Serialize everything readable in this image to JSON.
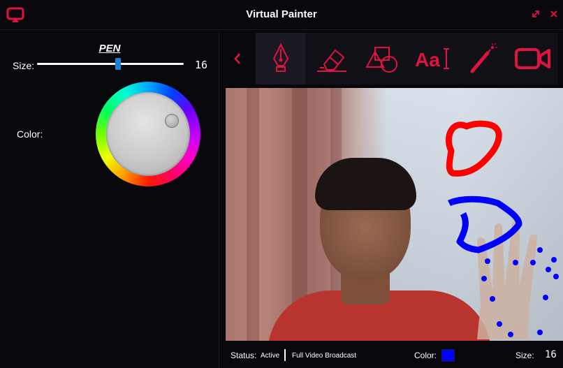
{
  "app": {
    "title": "Virtual Painter",
    "accent_color": "#e0123f",
    "logo_icon": "cast-screen-icon",
    "window_controls": [
      "restore-icon",
      "close-icon"
    ]
  },
  "left_panel": {
    "tool_name": "PEN",
    "size_label": "Size:",
    "size_value": "16",
    "size_fraction": 0.55,
    "color_label": "Color:"
  },
  "toolbar": {
    "items": [
      {
        "icon": "chevron-left-icon"
      },
      {
        "icon": "pen-icon",
        "active": true
      },
      {
        "icon": "eraser-icon"
      },
      {
        "icon": "shapes-icon"
      },
      {
        "icon": "text-icon",
        "label": "Aa"
      },
      {
        "icon": "laser-pointer-icon"
      },
      {
        "icon": "video-camera-icon"
      }
    ]
  },
  "status": {
    "label": "Status:",
    "value": "Active",
    "mode": "Full Video Broadcast",
    "color_label": "Color:",
    "color_value": "#0000ff",
    "size_label": "Size:",
    "size_value": "16"
  },
  "canvas": {
    "stroke_colors": [
      "#ff0000",
      "#0000ff"
    ]
  }
}
